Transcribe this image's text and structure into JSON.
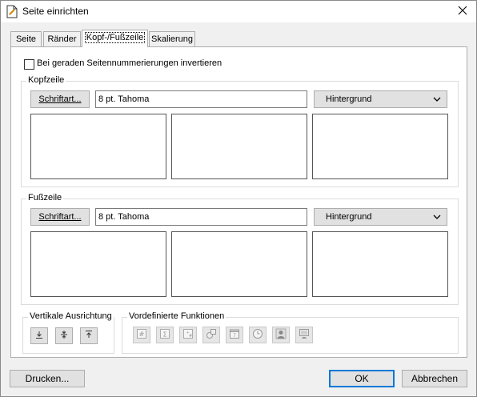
{
  "window": {
    "title": "Seite einrichten"
  },
  "tabs": [
    {
      "label": "Seite",
      "active": false
    },
    {
      "label": "Ränder",
      "active": false
    },
    {
      "label": "Kopf-/Fußzeile",
      "active": true
    },
    {
      "label": "Skalierung",
      "active": false
    }
  ],
  "options": {
    "invert_label": "Bei geraden Seitennummerierungen invertieren",
    "invert_checked": false
  },
  "header": {
    "group_label": "Kopfzeile",
    "font_button": "Schriftart...",
    "font_value": "8 pt. Tahoma",
    "background_value": "Hintergrund"
  },
  "footer": {
    "group_label": "Fußzeile",
    "font_button": "Schriftart...",
    "font_value": "8 pt. Tahoma",
    "background_value": "Hintergrund"
  },
  "alignment": {
    "group_label": "Vertikale Ausrichtung",
    "buttons": [
      "align-bottom-icon",
      "align-middle-icon",
      "align-top-icon"
    ]
  },
  "functions": {
    "group_label": "Vordefinierte Funktionen",
    "buttons": [
      "page-number-icon",
      "sum-icon",
      "page-count-icon",
      "shapes-icon",
      "date-icon",
      "time-icon",
      "user-icon",
      "computer-icon"
    ]
  },
  "bottom": {
    "print_label": "Drucken...",
    "ok_label": "OK",
    "cancel_label": "Abbrechen"
  },
  "colors": {
    "accent": "#0078d7",
    "panel_bg": "#ffffff",
    "window_bg": "#f0f0f0"
  }
}
